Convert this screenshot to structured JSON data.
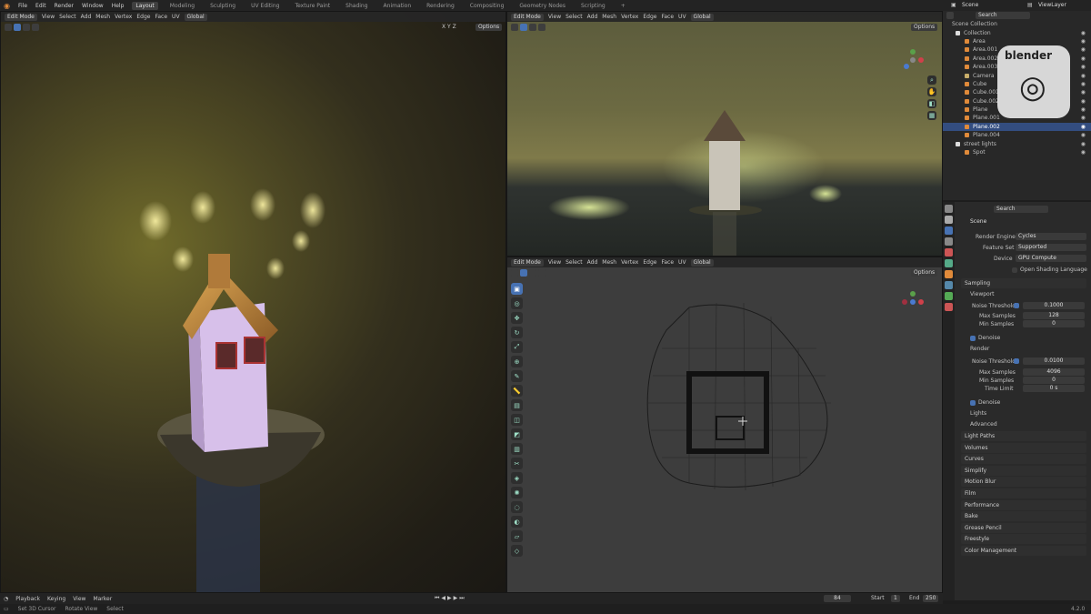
{
  "app": {
    "logo_text": "blender",
    "version": "4.2.0"
  },
  "menu": [
    "File",
    "Edit",
    "Render",
    "Window",
    "Help"
  ],
  "workspaces": [
    "Layout",
    "Modeling",
    "Sculpting",
    "UV Editing",
    "Texture Paint",
    "Shading",
    "Animation",
    "Rendering",
    "Compositing",
    "Geometry Nodes",
    "Scripting"
  ],
  "active_workspace": "Layout",
  "scene_name": "Scene",
  "view_layer": "ViewLayer",
  "viewport": {
    "mode": "Edit Mode",
    "menus": [
      "View",
      "Select",
      "Add",
      "Mesh",
      "Vertex",
      "Edge",
      "Face",
      "UV"
    ],
    "transform": "Global",
    "options": "Options",
    "axes": "X Y Z"
  },
  "tools": [
    "select-box",
    "cursor",
    "move",
    "rotate",
    "scale",
    "transform",
    "annotate",
    "measure",
    "extrude",
    "inset",
    "bevel",
    "loop-cut",
    "knife",
    "poly-build",
    "spin",
    "smooth",
    "shrink",
    "shear",
    "rip"
  ],
  "outliner": {
    "search": "Search",
    "root": "Scene Collection",
    "items": [
      {
        "name": "Collection",
        "type": "collection"
      },
      {
        "name": "Area",
        "type": "light"
      },
      {
        "name": "Area.001",
        "type": "light"
      },
      {
        "name": "Area.002",
        "type": "light"
      },
      {
        "name": "Area.003",
        "type": "light"
      },
      {
        "name": "Camera",
        "type": "camera"
      },
      {
        "name": "Cube",
        "type": "mesh"
      },
      {
        "name": "Cube.001",
        "type": "mesh"
      },
      {
        "name": "Cube.002",
        "type": "mesh"
      },
      {
        "name": "Plane",
        "type": "mesh"
      },
      {
        "name": "Plane.001",
        "type": "mesh"
      },
      {
        "name": "Plane.002",
        "type": "mesh",
        "selected": true
      },
      {
        "name": "Plane.004",
        "type": "mesh"
      },
      {
        "name": "street lights",
        "type": "collection"
      },
      {
        "name": "Spot",
        "type": "light"
      }
    ]
  },
  "properties": {
    "search": "Search",
    "scene": "Scene",
    "render_engine_label": "Render Engine",
    "render_engine": "Cycles",
    "feature_set_label": "Feature Set",
    "feature_set": "Supported",
    "device_label": "Device",
    "device": "GPU Compute",
    "osl": "Open Shading Language",
    "sampling": "Sampling",
    "viewport": "Viewport",
    "noise_threshold_label": "Noise Threshold",
    "viewport_noise": "0.1000",
    "max_samples_label": "Max Samples",
    "viewport_max": "128",
    "min_samples_label": "Min Samples",
    "viewport_min": "0",
    "denoise": "Denoise",
    "render": "Render",
    "render_noise": "0.0100",
    "render_max": "4096",
    "render_min": "0",
    "time_limit_label": "Time Limit",
    "time_limit": "0 s",
    "lights": "Lights",
    "advanced": "Advanced",
    "panels": [
      "Light Paths",
      "Volumes",
      "Curves",
      "Simplify",
      "Motion Blur",
      "Film",
      "Performance",
      "Bake",
      "Grease Pencil",
      "Freestyle",
      "Color Management"
    ]
  },
  "timeline": {
    "menus": [
      "Playback",
      "Keying",
      "View",
      "Marker"
    ],
    "current": "84",
    "start_label": "Start",
    "start": "1",
    "end_label": "End",
    "end": "250"
  },
  "statusbar": [
    "Set 3D Cursor",
    "Rotate View",
    "Select"
  ],
  "colors": {
    "accent": "#4772b3",
    "orange": "#e08a3a",
    "bg": "#1d1d1d"
  }
}
